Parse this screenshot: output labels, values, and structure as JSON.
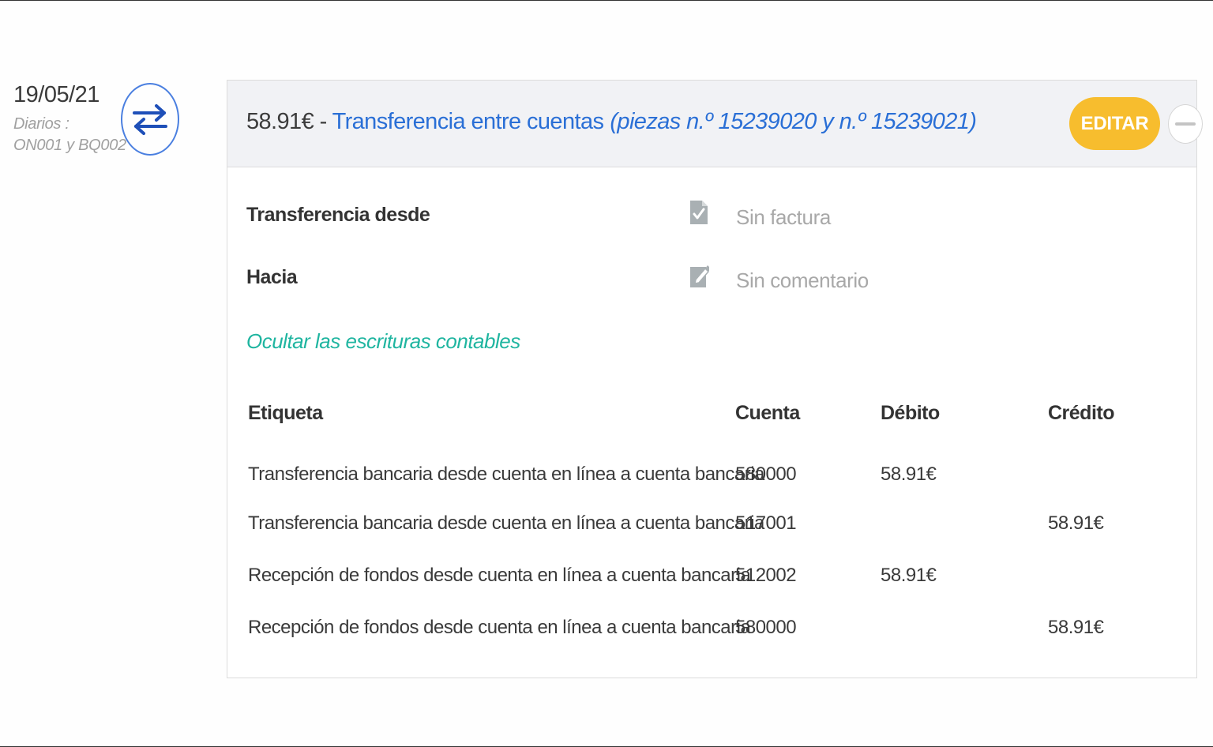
{
  "entry": {
    "date": "19/05/21",
    "journals_label": "Diarios :",
    "journals_codes": "ON001 y BQ002",
    "type_icon": "swap-arrows-icon"
  },
  "header": {
    "amount": "58.91€",
    "separator": " - ",
    "title": "Transferencia entre cuentas",
    "pieces": "(piezas n.º 15239020 y n.º 15239021)",
    "edit_label": "EDITAR",
    "collapse_icon": "minus-icon"
  },
  "fields": {
    "from_label": "Transferencia desde",
    "to_label": "Hacia",
    "invoice_value": "Sin factura",
    "comment_value": "Sin comentario"
  },
  "toggle_entries_label": "Ocultar las escrituras contables",
  "table": {
    "headers": {
      "label": "Etiqueta",
      "account": "Cuenta",
      "debit": "Débito",
      "credit": "Crédito"
    },
    "rows": [
      {
        "label": "Transferencia bancaria desde cuenta en línea a cuenta bancaria",
        "account": "580000",
        "debit": "58.91€",
        "credit": ""
      },
      {
        "label": "Transferencia bancaria desde cuenta en línea a cuenta bancaria",
        "account": "517001",
        "debit": "",
        "credit": "58.91€"
      },
      {
        "label": "Recepción de fondos desde cuenta en línea a cuenta bancaria",
        "account": "512002",
        "debit": "58.91€",
        "credit": ""
      },
      {
        "label": "Recepción de fondos desde cuenta en línea a cuenta bancaria",
        "account": "580000",
        "debit": "",
        "credit": "58.91€"
      }
    ]
  },
  "colors": {
    "accent_blue": "#2a6fd6",
    "edit_yellow": "#f7bd2e",
    "link_teal": "#1fb5a0",
    "muted_gray": "#a8a8a8"
  }
}
